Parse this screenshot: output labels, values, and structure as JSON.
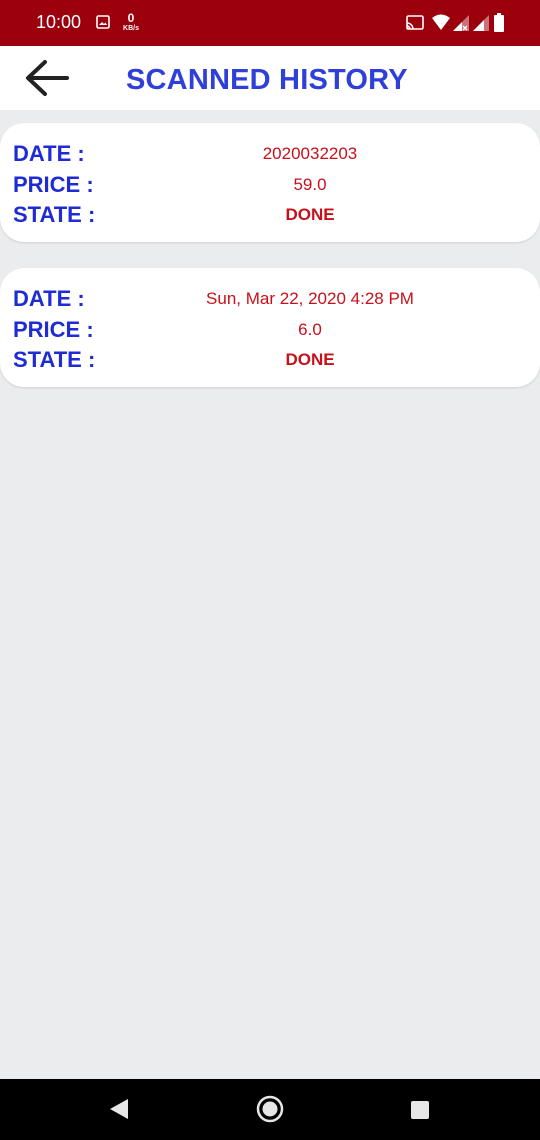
{
  "status_bar": {
    "time": "10:00",
    "net_speed_value": "0",
    "net_speed_unit": "KB/s",
    "icons": [
      "gallery-icon",
      "cast-icon",
      "wifi-icon",
      "signal-icon",
      "signal-icon",
      "battery-icon"
    ]
  },
  "header": {
    "back_icon": "arrow-left-icon",
    "title": "SCANNED HISTORY"
  },
  "labels": {
    "date": "DATE :",
    "price": "PRICE :",
    "state": "STATE :"
  },
  "history": [
    {
      "date": "2020032203",
      "price": "59.0",
      "state": "DONE"
    },
    {
      "date": "Sun, Mar 22, 2020 4:28 PM",
      "price": "6.0",
      "state": "DONE"
    }
  ],
  "nav_bar": {
    "icons": [
      "nav-back-icon",
      "nav-home-icon",
      "nav-recents-icon"
    ]
  },
  "colors": {
    "status_bar": "#9c000c",
    "title": "#2f3fd9",
    "label": "#1f2bd3",
    "value": "#c8101a",
    "background": "#ebecee"
  }
}
